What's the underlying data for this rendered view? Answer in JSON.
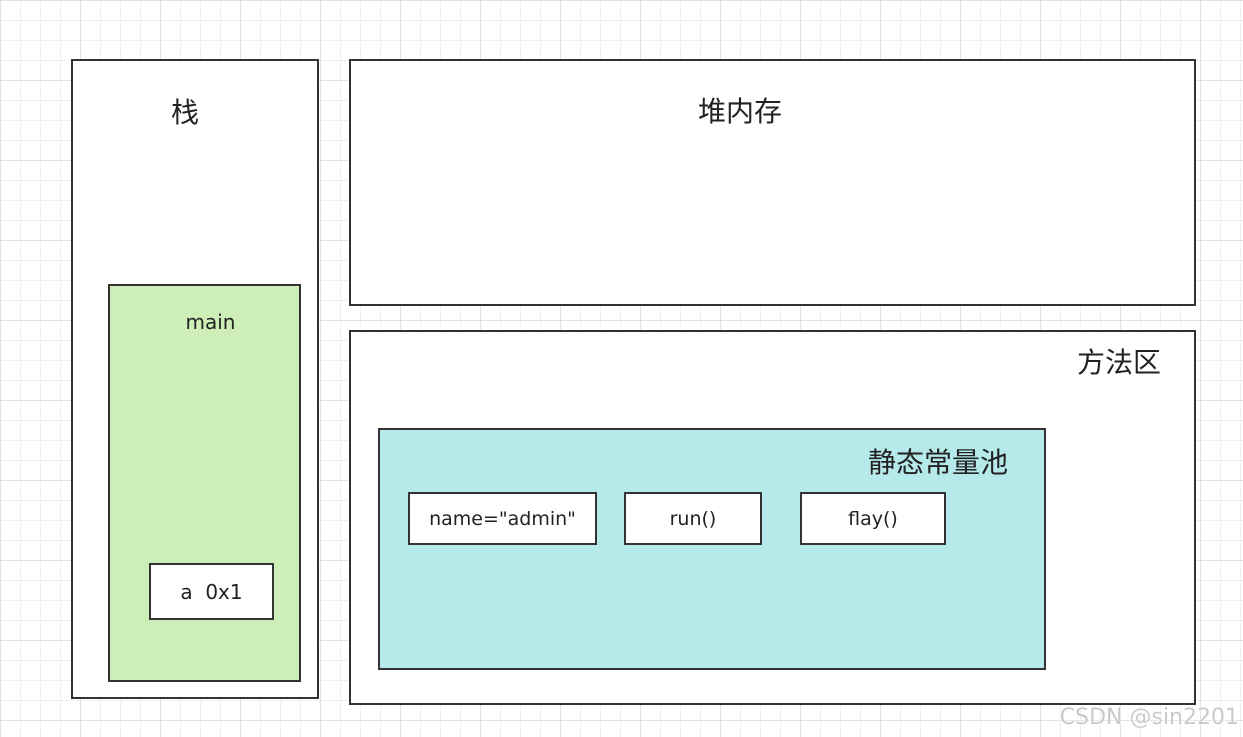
{
  "stack": {
    "title": "栈",
    "frame": {
      "title": "main",
      "variable": "a  0x1"
    }
  },
  "heap": {
    "title": "堆内存"
  },
  "method_area": {
    "title": "方法区",
    "constant_pool": {
      "title": "静态常量池",
      "items": [
        "name=\"admin\"",
        "run()",
        "flay()"
      ]
    }
  },
  "watermark": "CSDN @sin2201",
  "colors": {
    "frame_fill": "#cdeeb7",
    "pool_fill": "#b6e9ea",
    "border": "#333333"
  }
}
